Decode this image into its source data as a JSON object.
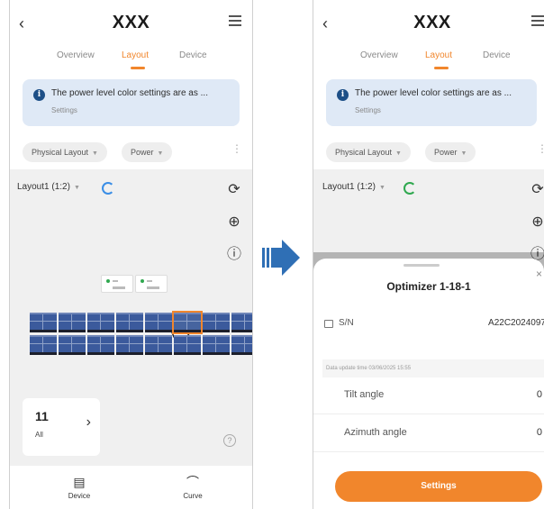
{
  "left_screen": {
    "back_icon": "chevron-left",
    "title": "XXX",
    "tabs": [
      {
        "label": "Overview"
      },
      {
        "label": "Layout",
        "active": true
      },
      {
        "label": "Device"
      }
    ],
    "banner": {
      "text": "The power level color settings are as ...",
      "link": "Settings"
    },
    "filters": {
      "view": "Physical Layout",
      "metric": "Power"
    },
    "layout_select": "Layout1 (1:2)",
    "count_card": {
      "value": "11",
      "label": "All"
    },
    "nav": [
      {
        "label": "Device",
        "icon": "device-icon"
      },
      {
        "label": "Curve",
        "icon": "curve-icon"
      }
    ]
  },
  "right_screen": {
    "title": "XXX",
    "tabs": [
      {
        "label": "Overview"
      },
      {
        "label": "Layout",
        "active": true
      },
      {
        "label": "Device"
      }
    ],
    "banner": {
      "text": "The power level color settings are as ...",
      "link": "Settings"
    },
    "filters": {
      "view": "Physical Layout",
      "metric": "Power"
    },
    "layout_select": "Layout1 (1:2)",
    "sheet": {
      "title": "Optimizer 1-18-1",
      "sn_label": "S/N",
      "sn_value": "A22C2024097",
      "data_time": "Data update time 03/06/2025 15:55",
      "rows": [
        {
          "label": "Tilt angle",
          "value": "0"
        },
        {
          "label": "Azimuth angle",
          "value": "0"
        }
      ],
      "button": "Settings"
    }
  },
  "colors": {
    "accent": "#f1862c",
    "module": "#3b5a9c",
    "banner_bg": "#dfe9f6",
    "arrow": "#2f6fb5"
  }
}
